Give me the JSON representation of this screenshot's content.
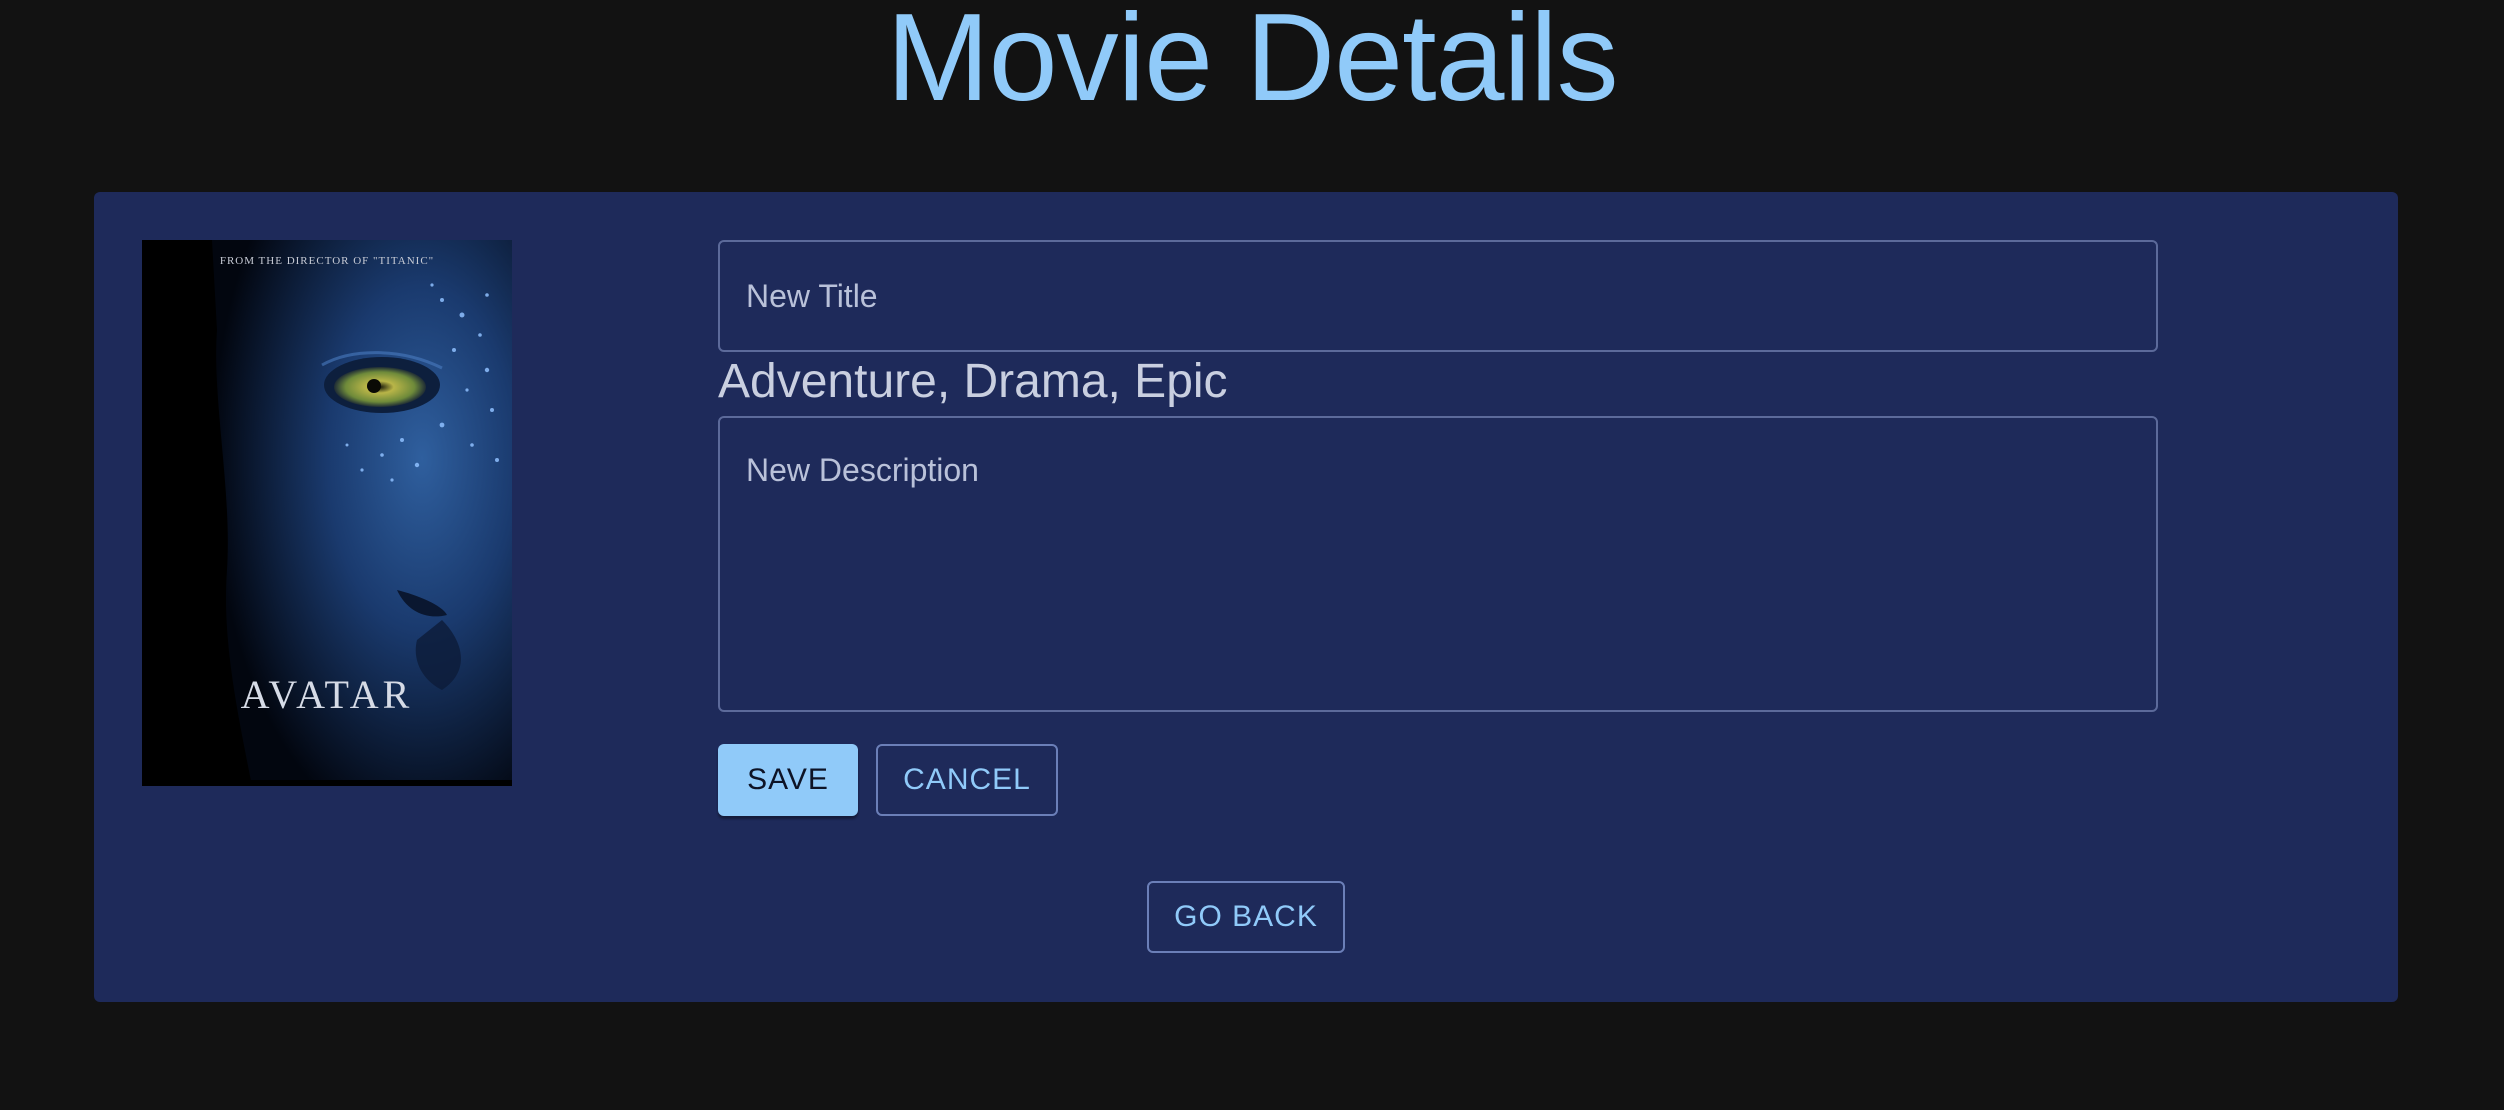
{
  "header": {
    "title": "Movie Details"
  },
  "movie": {
    "poster": {
      "tagline": "FROM THE DIRECTOR OF \"TITANIC\"",
      "title": "AVATAR"
    },
    "title_field": {
      "placeholder": "New Title",
      "value": ""
    },
    "genres": "Adventure, Drama, Epic",
    "description_field": {
      "placeholder": "New Description",
      "value": ""
    }
  },
  "actions": {
    "save_label": "SAVE",
    "cancel_label": "CANCEL",
    "back_label": "GO BACK"
  },
  "colors": {
    "background": "#121212",
    "card": "#1e2a5a",
    "accent": "#90caf9"
  }
}
